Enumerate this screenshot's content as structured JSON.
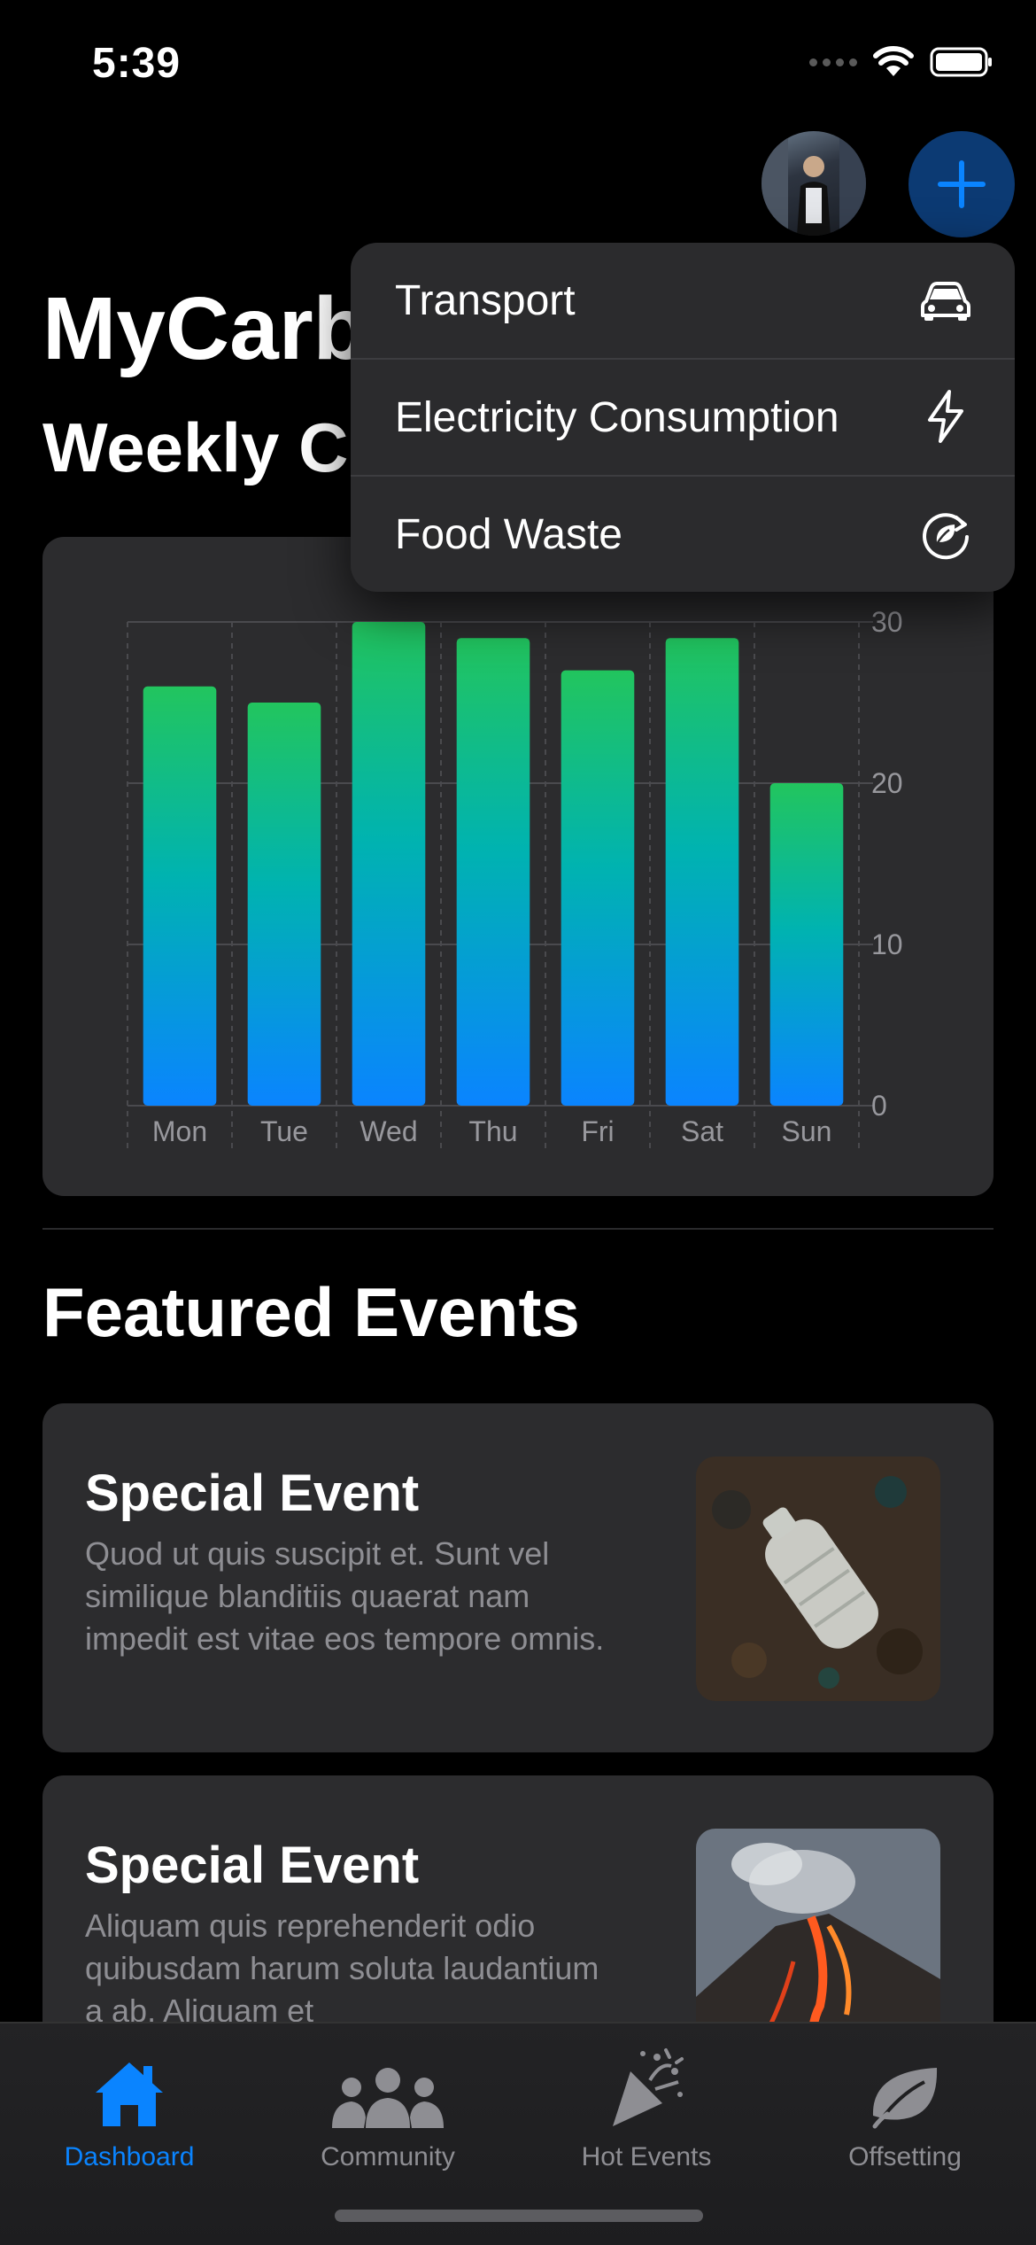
{
  "status_bar": {
    "time": "5:39"
  },
  "header": {
    "app_title": "MyCarb",
    "chart_heading": "Weekly C"
  },
  "menu": {
    "items": [
      {
        "label": "Transport",
        "icon": "car-icon"
      },
      {
        "label": "Electricity Consumption",
        "icon": "bolt-icon"
      },
      {
        "label": "Food Waste",
        "icon": "recycle-leaf-icon"
      }
    ]
  },
  "chart_data": {
    "type": "bar",
    "categories": [
      "Mon",
      "Tue",
      "Wed",
      "Thu",
      "Fri",
      "Sat",
      "Sun"
    ],
    "values": [
      26,
      25,
      30,
      29,
      27,
      29,
      20
    ],
    "ylim": [
      0,
      30
    ],
    "yticks": [
      0,
      10,
      20,
      30
    ],
    "y_axis_position": "right",
    "grid": true,
    "colors": {
      "bar_top": "#22c55e",
      "bar_mid": "#00b3b0",
      "bar_bottom": "#0a84ff"
    }
  },
  "featured": {
    "title": "Featured Events",
    "events": [
      {
        "title": "Special Event",
        "description": "Quod ut quis suscipit et. Sunt vel similique blanditiis quaerat nam impedit est vitae eos tempore omnis."
      },
      {
        "title": "Special Event",
        "description": "Aliquam quis reprehenderit odio quibusdam harum soluta laudantium a ab. Aliquam et"
      }
    ]
  },
  "tab_bar": {
    "tabs": [
      {
        "label": "Dashboard",
        "icon": "house-icon",
        "active": true
      },
      {
        "label": "Community",
        "icon": "people-icon",
        "active": false
      },
      {
        "label": "Hot Events",
        "icon": "party-popper-icon",
        "active": false
      },
      {
        "label": "Offsetting",
        "icon": "leaf-icon",
        "active": false
      }
    ]
  },
  "colors": {
    "accent": "#0a84ff",
    "card": "#2c2c2e",
    "add_button": "#0c3a73"
  }
}
